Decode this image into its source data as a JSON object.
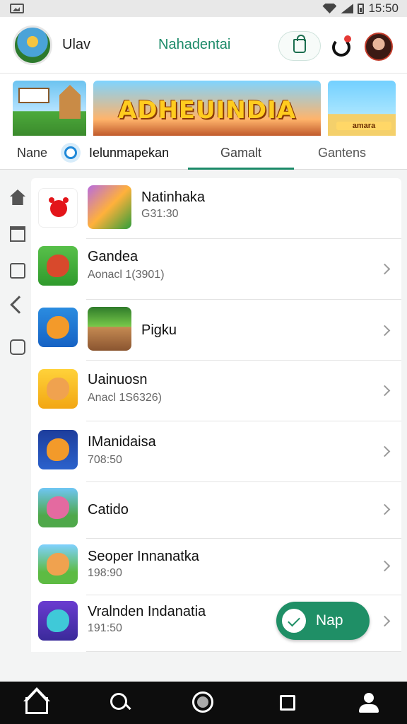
{
  "status_bar": {
    "time": "15:50"
  },
  "header": {
    "user_name": "Ulav",
    "title": "Nahadentai"
  },
  "banner": {
    "title": "ADHEUINDIA",
    "side_caption": "amara"
  },
  "tabs": [
    {
      "label": "Nane"
    },
    {
      "label": "Ielunmapekan"
    },
    {
      "label": "Gamalt"
    },
    {
      "label": "Gantens"
    }
  ],
  "list": [
    {
      "title": "Natinhaka",
      "subtitle": "G31:30"
    },
    {
      "title": "Gandea",
      "subtitle": "Aonacl  1(3901)"
    },
    {
      "title": "Pigku",
      "subtitle": ""
    },
    {
      "title": "Uainuosn",
      "subtitle": "Anacl  1S6326)"
    },
    {
      "title": "IManidaisa",
      "subtitle": "708:50"
    },
    {
      "title": "Catido",
      "subtitle": ""
    },
    {
      "title": "Seoper  Innanatka",
      "subtitle": "198:90"
    },
    {
      "title": "Vralnden Indanatia",
      "subtitle": "191:50"
    }
  ],
  "play_button": {
    "label": "Nap"
  },
  "colors": {
    "accent": "#1b8a68",
    "play": "#1f8f66",
    "nav_bg": "#0d0d0d"
  },
  "icons": [
    "home-icon",
    "trash-icon",
    "folder-icon",
    "back-icon",
    "check-icon",
    "search-icon",
    "circle-icon",
    "square-icon",
    "profile-icon",
    "bag-icon",
    "refresh-icon"
  ]
}
